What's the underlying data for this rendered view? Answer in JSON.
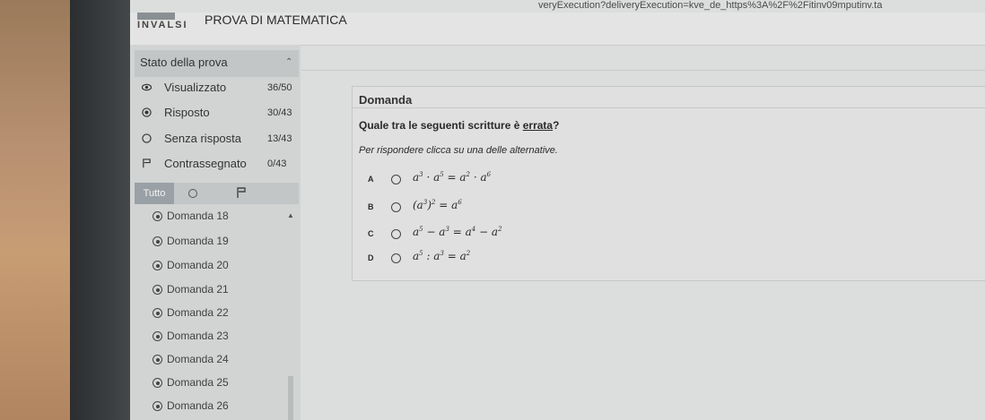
{
  "browser": {
    "url_fragment": "veryExecution?deliveryExecution=kve_de_https%3A%2F%2Fitinv09mputinv.ta"
  },
  "header": {
    "logo": "INVALSI",
    "title": "PROVA DI MATEMATICA"
  },
  "sidebar": {
    "status_title": "Stato della prova",
    "status": [
      {
        "label": "Visualizzato",
        "count": "36/50"
      },
      {
        "label": "Risposto",
        "count": "30/43"
      },
      {
        "label": "Senza risposta",
        "count": "13/43"
      },
      {
        "label": "Contrassegnato",
        "count": "0/43"
      }
    ],
    "filter_all": "Tutto",
    "questions": [
      "Domanda 18",
      "Domanda 19",
      "Domanda 20",
      "Domanda 21",
      "Domanda 22",
      "Domanda 23",
      "Domanda 24",
      "Domanda 25",
      "Domanda 26"
    ]
  },
  "question": {
    "heading": "Domanda",
    "text_before": "Quale tra le seguenti scritture è ",
    "text_underlined": "errata",
    "text_after": "?",
    "instruction": "Per rispondere clicca su una delle alternative.",
    "options": [
      {
        "letter": "A"
      },
      {
        "letter": "B"
      },
      {
        "letter": "C"
      },
      {
        "letter": "D"
      }
    ]
  }
}
